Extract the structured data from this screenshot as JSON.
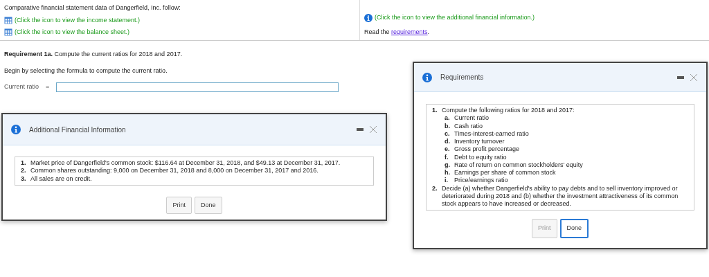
{
  "intro": {
    "text": "Comparative financial statement data of Dangerfield, Inc. follow:",
    "links": [
      {
        "text": "(Click the icon to view the income statement.)"
      },
      {
        "text": "(Click the icon to view the balance sheet.)"
      }
    ]
  },
  "info_link": {
    "text": "(Click the icon to view the additional financial information.)"
  },
  "read": {
    "prefix": "Read the",
    "link": "requirements",
    "suffix": "."
  },
  "requirement": {
    "text": "**Requirement 1a.** Compute the current ratios for 2018 and 2017.",
    "instruction": "Begin by selecting the formula to compute the current ratio."
  },
  "formula": {
    "label": "Current ratio",
    "operator": "="
  },
  "dialogs": [
    {
      "title": "Additional Financial Information",
      "items": [
        {
          "number": "1.",
          "text": "Market price of Dangerfield's common stock: $116.64 at December 31, 2018, and $49.13 at December 31, 2017."
        },
        {
          "number": "2.",
          "text": "Common shares outstanding: 9,000 on December 31, 2018 and 8,000 on December 31, 2017 and 2016."
        },
        {
          "number": "3.",
          "text": "All sales are on credit."
        }
      ],
      "buttons": [
        {
          "label": "Print",
          "disabled": false,
          "focused": false
        },
        {
          "label": "Done",
          "disabled": false,
          "focused": false
        }
      ]
    },
    {
      "title": "Requirements",
      "items": [
        {
          "number": "1.",
          "text": "Compute the following ratios for 2018 and 2017:",
          "children": [
            {
              "number": "a.",
              "text": "Current ratio"
            },
            {
              "number": "b.",
              "text": "Cash ratio"
            },
            {
              "number": "c.",
              "text": "Times-interest-earned ratio"
            },
            {
              "number": "d.",
              "text": "Inventory turnover"
            },
            {
              "number": "e.",
              "text": "Gross profit percentage"
            },
            {
              "number": "f.",
              "text": "Debt to equity ratio"
            },
            {
              "number": "g.",
              "text": "Rate of return on common stockholders' equity"
            },
            {
              "number": "h.",
              "text": "Earnings per share of common stock"
            },
            {
              "number": "i.",
              "text": "Price/earnings ratio"
            }
          ]
        },
        {
          "number": "2.",
          "text": "Decide (a) whether Dangerfield's ability to pay debts and to sell inventory improved or deteriorated during 2018 and (b) whether the investment attractiveness of its common stock appears to have increased or decreased."
        }
      ],
      "buttons": [
        {
          "label": "Print",
          "disabled": true,
          "focused": false
        },
        {
          "label": "Done",
          "disabled": false,
          "focused": true
        }
      ]
    }
  ]
}
